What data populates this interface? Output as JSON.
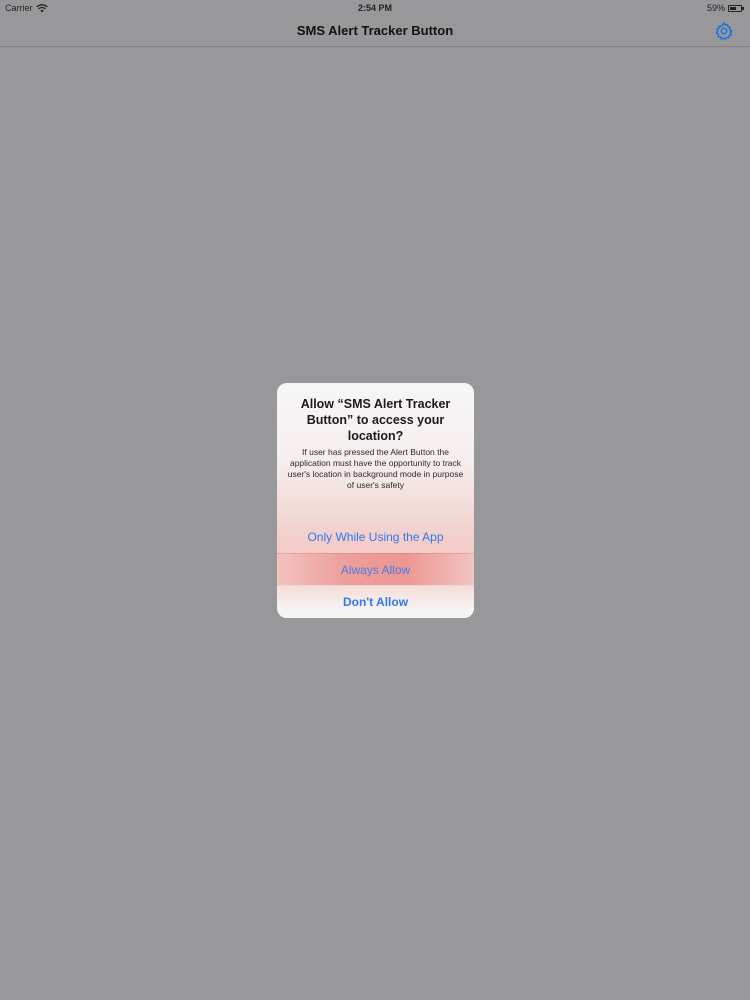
{
  "status_bar": {
    "carrier": "Carrier",
    "time": "2:54 PM",
    "battery": "59%",
    "battery_level": 0.59,
    "wifi_icon": "wifi-icon",
    "battery_icon": "battery-icon"
  },
  "nav": {
    "title": "SMS Alert Tracker Button",
    "settings_icon": "gear-icon",
    "accent_color": "#1a73e8"
  },
  "alert": {
    "title": "Allow “SMS Alert Tracker Button” to access your location?",
    "message": "If user has pressed the Alert Button the application must have the opportunity to track user's location in background mode in purpose of user's safety",
    "buttons": [
      {
        "label": "Only While Using the App"
      },
      {
        "label": "Always Allow"
      },
      {
        "label": "Don't Allow"
      }
    ],
    "button_color": "#3478f0"
  }
}
